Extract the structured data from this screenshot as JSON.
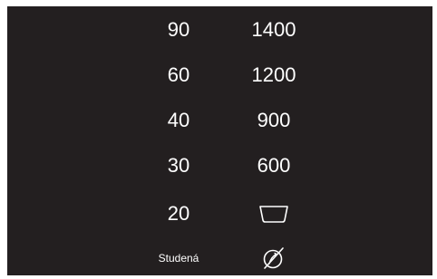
{
  "temperature_options": [
    {
      "label": "90"
    },
    {
      "label": "60"
    },
    {
      "label": "40"
    },
    {
      "label": "30"
    },
    {
      "label": "20"
    },
    {
      "label": "Studená"
    }
  ],
  "spin_options": [
    {
      "label": "1400"
    },
    {
      "label": "1200"
    },
    {
      "label": "900"
    },
    {
      "label": "600"
    },
    {
      "icon": "rinse-hold-tub-icon"
    },
    {
      "icon": "no-spin-icon"
    }
  ],
  "colors": {
    "panel_background": "#231f20",
    "text": "#ffffff"
  }
}
